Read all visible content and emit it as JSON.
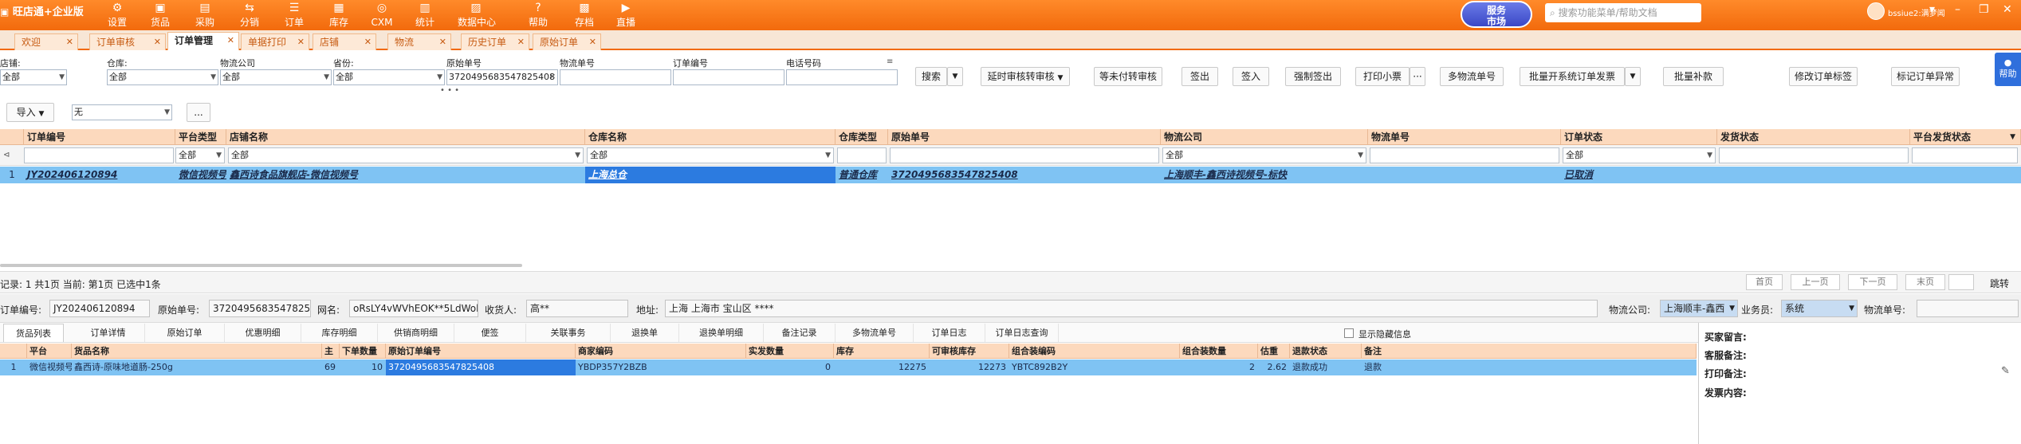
{
  "app": {
    "title": "旺店通+企业版"
  },
  "topnav": [
    {
      "icon": "⚙",
      "label": "设置"
    },
    {
      "icon": "▣",
      "label": "货品"
    },
    {
      "icon": "▤",
      "label": "采购"
    },
    {
      "icon": "⇆",
      "label": "分销"
    },
    {
      "icon": "☰",
      "label": "订单"
    },
    {
      "icon": "▦",
      "label": "库存"
    },
    {
      "icon": "◎",
      "label": "CXM"
    },
    {
      "icon": "▥",
      "label": "统计"
    },
    {
      "icon": "▨",
      "label": "数据中心"
    },
    {
      "icon": "?",
      "label": "帮助"
    },
    {
      "icon": "▩",
      "label": "存档"
    },
    {
      "icon": "▶",
      "label": "直播"
    }
  ],
  "service_market": {
    "line1": "服务",
    "line2": "市场"
  },
  "top_search": {
    "placeholder": "搜索功能菜单/帮助文档"
  },
  "user": {
    "name": "bssiue2:满梦闻"
  },
  "window_controls": [
    "▾",
    "–",
    "❐",
    "✕"
  ],
  "tabs": [
    {
      "label": "欢迎"
    },
    {
      "label": "订单审核"
    },
    {
      "label": "订单管理"
    },
    {
      "label": "单据打印"
    },
    {
      "label": "店铺"
    },
    {
      "label": "物流"
    },
    {
      "label": "历史订单"
    },
    {
      "label": "原始订单"
    }
  ],
  "filters": {
    "shop": {
      "label": "店铺:",
      "value": "全部"
    },
    "warehouse": {
      "label": "仓库:",
      "value": "全部"
    },
    "logistics": {
      "label": "物流公司",
      "value": "全部"
    },
    "province": {
      "label": "省份:",
      "value": "全部"
    },
    "original_no": {
      "label": "原始单号",
      "value": "3720495683547825408"
    },
    "tracking_no": {
      "label": "物流单号",
      "value": ""
    },
    "order_no": {
      "label": "订单编号",
      "value": ""
    },
    "phone": {
      "label": "电话号码",
      "value": ""
    },
    "import_label": "导入",
    "import_value": "无",
    "more": "..."
  },
  "toolbar": {
    "search": "搜索",
    "delay_audit": "延时审核转审核",
    "wait_pay": "等未付转审核",
    "sign_out": "签出",
    "sign_in": "签入",
    "force_sign_out": "强制签出",
    "print_ticket": "打印小票",
    "more_dots": "···",
    "multi_logistics": "多物流单号",
    "batch_invoice": "批量开系统订单发票",
    "batch_supplement": "批量补款",
    "modify_tag": "修改订单标签",
    "mark_exception": "标记订单异常",
    "help": "帮助"
  },
  "grid": {
    "headers": [
      "订单编号",
      "平台类型",
      "店铺名称",
      "仓库名称",
      "仓库类型",
      "原始单号",
      "物流公司",
      "物流单号",
      "订单状态",
      "发货状态",
      "平台发货状态"
    ],
    "filter_values": [
      "",
      "全部",
      "全部",
      "全部",
      "",
      "",
      "全部",
      "",
      "全部",
      "",
      ""
    ],
    "row": {
      "index": "1",
      "order_no": "JY202406120894",
      "platform": "微信视频号",
      "shop": "鑫西诗食品旗舰店-微信视频号",
      "warehouse": "上海总仓",
      "wh_type": "普通仓库",
      "original_no": "3720495683547825408",
      "logistics": "上海顺丰-鑫西诗视频号-标快",
      "tracking": "",
      "status": "已取消",
      "ship_status": "",
      "platform_ship": ""
    }
  },
  "status_bar": {
    "text": "记录: 1  共1页  当前: 第1页  已选中1条",
    "first": "首页",
    "prev": "上一页",
    "next": "下一页",
    "last": "末页",
    "jump": "跳转"
  },
  "detail_info": {
    "order_no_label": "订单编号:",
    "order_no": "JY202406120894",
    "orig_label": "原始单号:",
    "orig": "3720495683547825408",
    "nick_label": "网名:",
    "nick": "oRsLY4vWVhEOK**5LdWol",
    "receiver_label": "收货人:",
    "receiver": "高**",
    "addr_label": "地址:",
    "addr": "上海 上海市 宝山区 ****",
    "logistics_label": "物流公司:",
    "logistics": "上海顺丰-鑫西",
    "salesman_label": "业务员:",
    "salesman": "系统",
    "tracking_label": "物流单号:",
    "tracking": ""
  },
  "detail_tabs": [
    "货品列表",
    "订单详情",
    "原始订单",
    "优惠明细",
    "库存明细",
    "供销商明细",
    "便签",
    "关联事务",
    "退换单",
    "退换单明细",
    "备注记录",
    "多物流单号",
    "订单日志",
    "订单日志查询"
  ],
  "show_hidden": "显示隐藏信息",
  "detail_grid": {
    "headers": [
      "平台",
      "货品名称",
      "主",
      "下单数量",
      "原始订单编号",
      "商家编码",
      "实发数量",
      "库存",
      "可审核库存",
      "组合装编码",
      "组合装数量",
      "估重",
      "退款状态",
      "备注"
    ],
    "row": {
      "index": "1",
      "platform": "微信视频号",
      "goods": "鑫西诗-原味地道肠-250g",
      "main": "69",
      "qty": "10",
      "orig_no": "3720495683547825408",
      "code": "YBDP357Y2BZB",
      "ship_qty": "0",
      "stock": "12275",
      "audit_stock": "12273",
      "combo_code": "YBTC892B2Y",
      "combo_qty": "2",
      "weight": "2.62",
      "refund": "退款成功",
      "remark": "退款"
    }
  },
  "notes": {
    "buyer": "买家留言:",
    "service": "客服备注:",
    "print": "打印备注:",
    "invoice": "发票内容:"
  }
}
